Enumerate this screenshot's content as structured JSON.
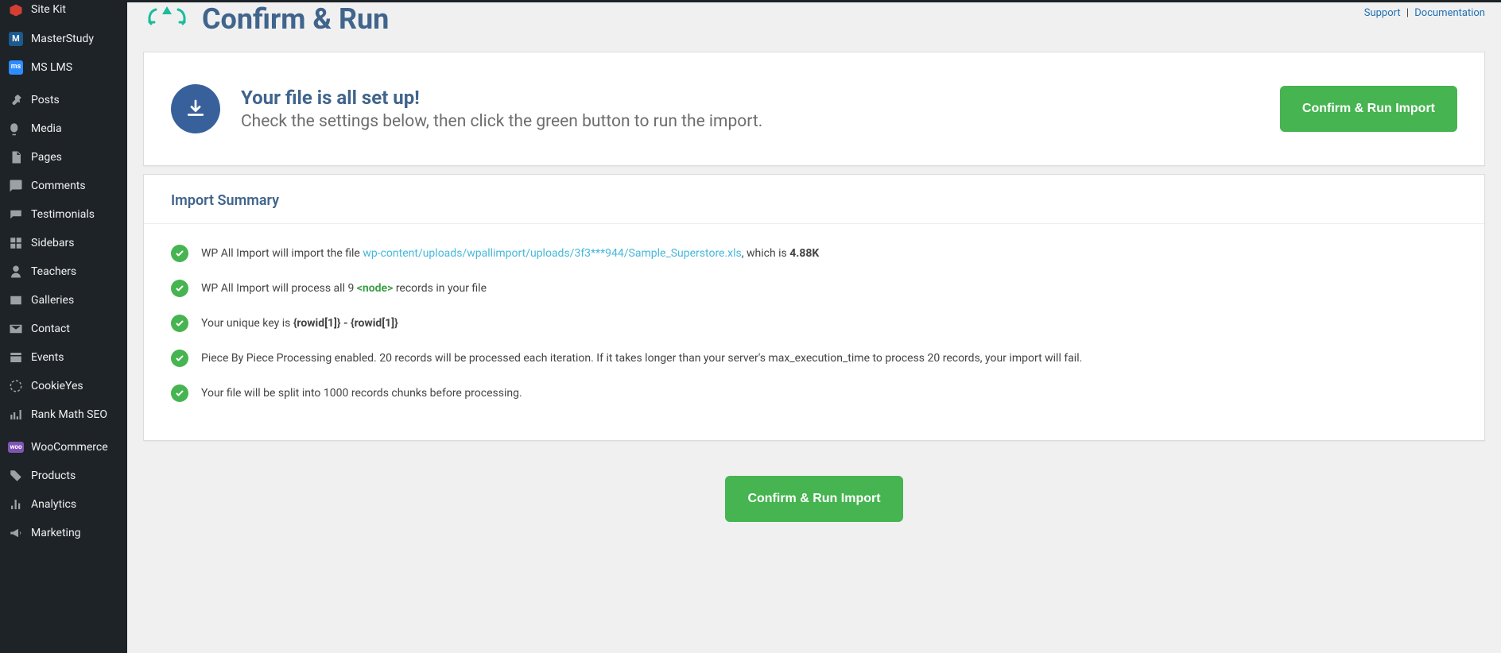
{
  "sidebar": {
    "items": [
      {
        "label": "Site Kit"
      },
      {
        "label": "MasterStudy"
      },
      {
        "label": "MS LMS"
      },
      {
        "label": "Posts"
      },
      {
        "label": "Media"
      },
      {
        "label": "Pages"
      },
      {
        "label": "Comments"
      },
      {
        "label": "Testimonials"
      },
      {
        "label": "Sidebars"
      },
      {
        "label": "Teachers"
      },
      {
        "label": "Galleries"
      },
      {
        "label": "Contact"
      },
      {
        "label": "Events"
      },
      {
        "label": "CookieYes"
      },
      {
        "label": "Rank Math SEO"
      },
      {
        "label": "WooCommerce"
      },
      {
        "label": "Products"
      },
      {
        "label": "Analytics"
      },
      {
        "label": "Marketing"
      }
    ]
  },
  "header": {
    "title": "Confirm & Run",
    "support": "Support",
    "documentation": "Documentation"
  },
  "setup": {
    "heading": "Your file is all set up!",
    "sub": "Check the settings below, then click the green button to run the import.",
    "button": "Confirm & Run Import"
  },
  "summary": {
    "title": "Import Summary",
    "row1_prefix": "WP All Import will import the file ",
    "row1_file": "wp-content/uploads/wpallimport/uploads/3f3***944/Sample_Superstore.xls",
    "row1_mid": ", which is ",
    "row1_size": "4.88K",
    "row2_a": "WP All Import will process all 9 ",
    "row2_node": "<node>",
    "row2_b": " records in your file",
    "row3_a": "Your unique key is ",
    "row3_key": "{rowid[1]} - {rowid[1]}",
    "row4": "Piece By Piece Processing enabled. 20 records will be processed each iteration. If it takes longer than your server's max_execution_time to process 20 records, your import will fail.",
    "row5": "Your file will be split into 1000 records chunks before processing."
  },
  "bottom": {
    "button": "Confirm & Run Import"
  }
}
